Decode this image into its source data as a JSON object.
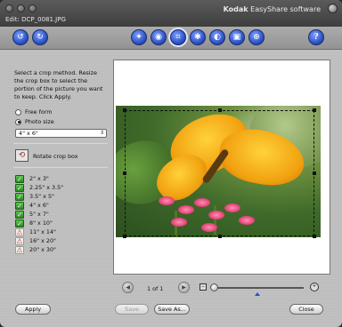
{
  "window": {
    "brand_bold": "Kodak",
    "brand_rest": " EasyShare software",
    "filename": "Edit: DCP_0081.JPG"
  },
  "toolbar": {
    "icons": [
      "undo-icon",
      "redo-icon",
      "enhance-icon",
      "red-eye-icon",
      "crop-icon",
      "effects-icon",
      "color-icon",
      "border-icon",
      "zoom-icon",
      "help-icon"
    ],
    "help_label": "?"
  },
  "panel": {
    "instructions": "Select a crop method. Resize the crop box to select the portion of the picture you want to keep. Click Apply.",
    "options": [
      {
        "label": "Free form",
        "selected": false
      },
      {
        "label": "Photo size",
        "selected": true
      }
    ],
    "size_select": "4\" x 6\"",
    "rotate_label": "Rotate crop box",
    "sizes": [
      {
        "label": "2\" x 3\"",
        "status": "ok"
      },
      {
        "label": "2.25\" x 3.5\"",
        "status": "ok"
      },
      {
        "label": "3.5\" x 5\"",
        "status": "ok"
      },
      {
        "label": "4\" x 6\"",
        "status": "ok"
      },
      {
        "label": "5\" x 7\"",
        "status": "ok"
      },
      {
        "label": "8\" x 10\"",
        "status": "ok"
      },
      {
        "label": "11\" x 14\"",
        "status": "warn"
      },
      {
        "label": "16\" x 20\"",
        "status": "warn"
      },
      {
        "label": "20\" x 30\"",
        "status": "warn"
      }
    ]
  },
  "pager": {
    "page_label": "1 of 1"
  },
  "buttons": {
    "apply": "Apply",
    "save": "Save",
    "save_as": "Save As...",
    "close": "Close"
  },
  "colors": {
    "toolbar_accent": "#2a4fc4",
    "ok_badge": "#3ea834",
    "warn_badge": "#c33a12"
  }
}
